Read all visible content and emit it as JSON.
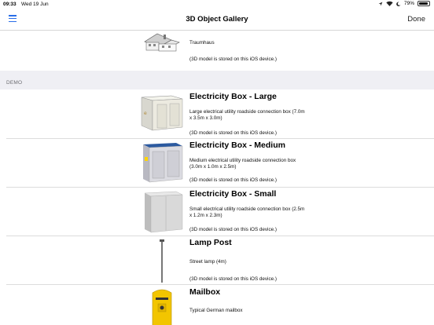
{
  "status": {
    "time": "09:33",
    "date": "Wed 19 Jun",
    "battery": "79%"
  },
  "nav": {
    "title": "3D Object Gallery",
    "done": "Done"
  },
  "section": {
    "label": "DEMO"
  },
  "items": [
    {
      "title": "",
      "desc": "Traumhaus",
      "note": "(3D model is stored on this iOS device.)"
    },
    {
      "title": "Electricity Box - Large",
      "desc": "Large electrical utility roadside connection box (7.0m x 3.5m x 3.0m)",
      "note": "(3D model is stored on this iOS device.)"
    },
    {
      "title": "Electricity Box - Medium",
      "desc": "Medium electrical utility roadside connection box (3.0m x 1.0m x 2.5m)",
      "note": "(3D model is stored on this iOS device.)"
    },
    {
      "title": "Electricity Box - Small",
      "desc": "Small electrical utility roadside connection box (2.5m x 1.2m x 2.3m)",
      "note": "(3D model is stored on this iOS device.)"
    },
    {
      "title": "Lamp Post",
      "desc": "Street lamp (4m)",
      "note": "(3D model is stored on this iOS device.)"
    },
    {
      "title": "Mailbox",
      "desc": "Typical German mailbox",
      "note": ""
    }
  ]
}
